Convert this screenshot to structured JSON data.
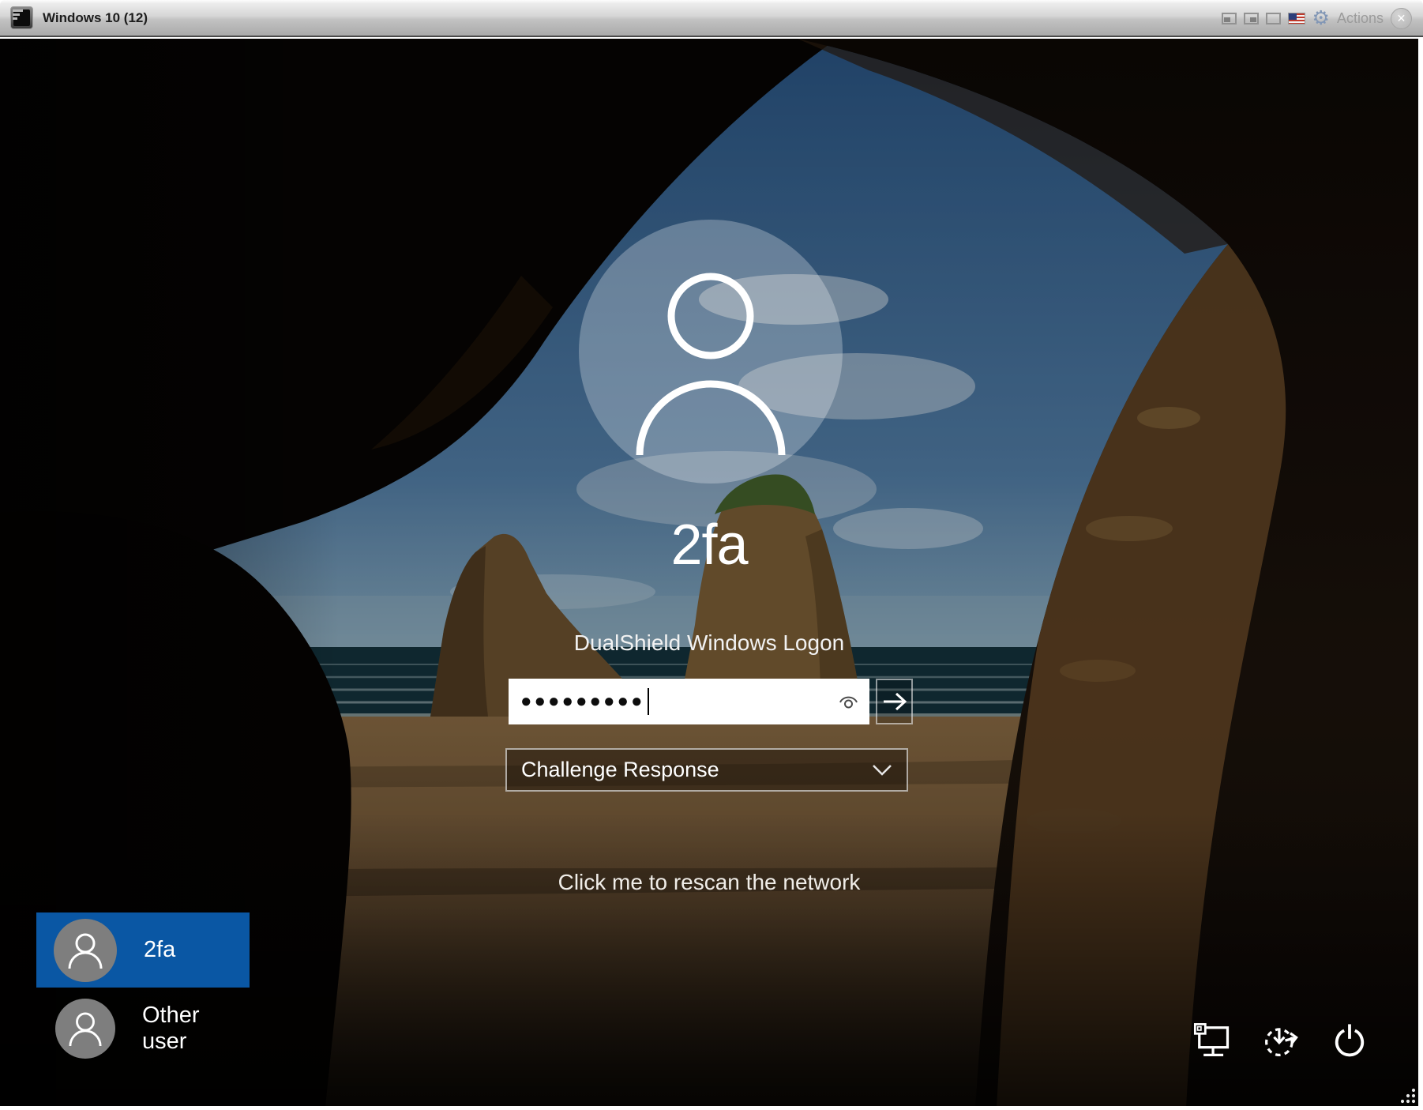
{
  "window": {
    "title": "Windows 10 (12)",
    "actions_label": "Actions"
  },
  "logon": {
    "username": "2fa",
    "product": "DualShield Windows Logon",
    "password_masked": "●●●●●●●●●",
    "auth_method": "Challenge Response",
    "rescan_label": "Click me to rescan the network"
  },
  "users": [
    {
      "name": "2fa",
      "selected": true
    },
    {
      "name": "Other user",
      "selected": false
    }
  ],
  "icons": {
    "gear": "⚙",
    "close": "✕"
  },
  "colors": {
    "selected_tile_blue": "#0a57a4",
    "titlebar_gray": "#c2c2c2",
    "screen_black": "#050505"
  }
}
